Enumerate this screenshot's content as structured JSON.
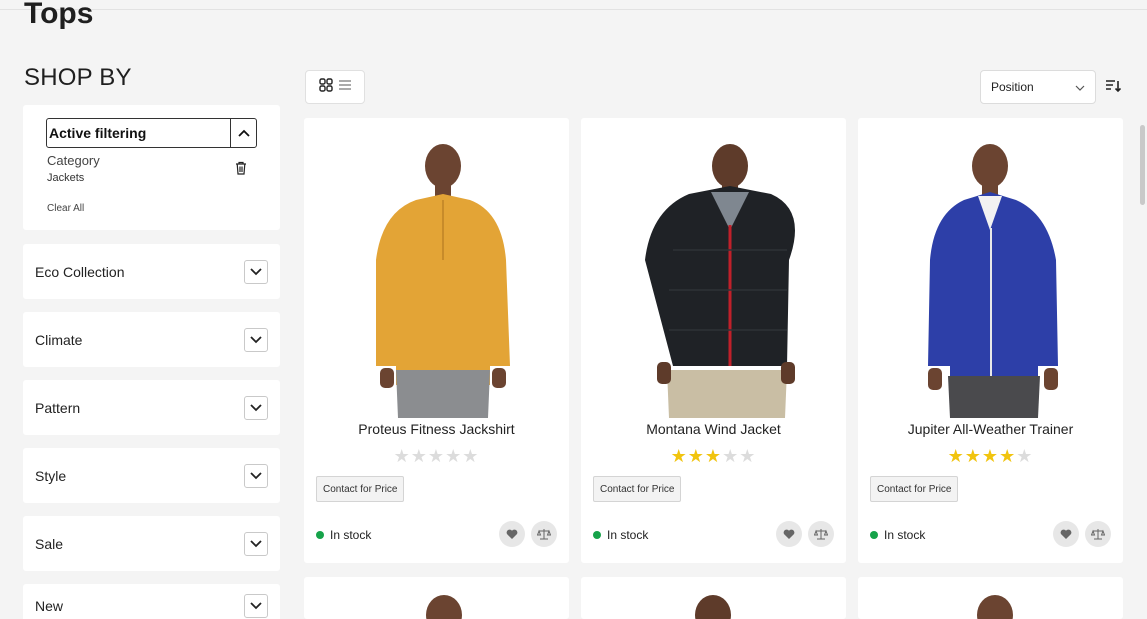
{
  "page": {
    "title": "Tops"
  },
  "sidebar": {
    "heading": "SHOP BY",
    "active_filtering": {
      "title": "Active filtering",
      "category_label": "Category",
      "category_value": "Jackets",
      "clear_all": "Clear All"
    },
    "filters": [
      {
        "label": "Eco Collection"
      },
      {
        "label": "Climate"
      },
      {
        "label": "Pattern"
      },
      {
        "label": "Style"
      },
      {
        "label": "Sale"
      },
      {
        "label": "New"
      }
    ]
  },
  "toolbar": {
    "sort_selected": "Position",
    "view_modes": [
      "grid-icon",
      "list-icon"
    ],
    "active_view": "grid"
  },
  "products": [
    {
      "name": "Proteus Fitness Jackshirt",
      "rating": 0,
      "rating_max": 5,
      "price_label": "Contact for Price",
      "stock": "In stock",
      "shirt_color": "#e3a436"
    },
    {
      "name": "Montana Wind Jacket",
      "rating": 3,
      "rating_max": 5,
      "price_label": "Contact for Price",
      "stock": "In stock",
      "shirt_color": "#1f2226"
    },
    {
      "name": "Jupiter All-Weather Trainer",
      "rating": 4,
      "rating_max": 5,
      "price_label": "Contact for Price",
      "stock": "In stock",
      "shirt_color": "#2d3fa8"
    }
  ],
  "colors": {
    "in_stock": "#16a34a",
    "star_on": "#f1c40f",
    "star_off": "#dcdcdc"
  }
}
